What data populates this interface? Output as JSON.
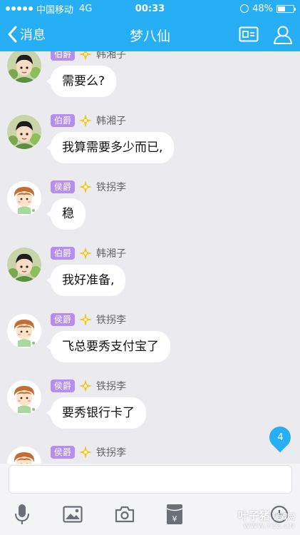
{
  "status_bar": {
    "carrier": "中国移动",
    "network": "4G",
    "time": "00:33",
    "battery": "48%",
    "battery_level": 0.48
  },
  "nav": {
    "back_label": "消息",
    "title": "梦八仙"
  },
  "messages": [
    {
      "rank": "伯爵",
      "sender": "韩湘子",
      "text": "需要么?"
    },
    {
      "rank": "伯爵",
      "sender": "韩湘子",
      "text": "我算需要多少而已,"
    },
    {
      "rank": "侯爵",
      "sender": "铁拐李",
      "text": "稳"
    },
    {
      "rank": "伯爵",
      "sender": "韩湘子",
      "text": "我好准备,"
    },
    {
      "rank": "侯爵",
      "sender": "铁拐李",
      "text": "飞总要秀支付宝了"
    },
    {
      "rank": "侯爵",
      "sender": "铁拐李",
      "text": "要秀银行卡了"
    },
    {
      "rank": "侯爵",
      "sender": "铁拐李",
      "text": ""
    }
  ],
  "unread_count": "4",
  "input": {
    "value": "",
    "placeholder": ""
  },
  "toolbar": [
    "microphone-icon",
    "image-icon",
    "camera-icon",
    "red-packet-icon",
    "more-icon"
  ],
  "watermark": {
    "main": "叶子猪",
    "sub": "游戏网",
    "url": "WWW.YZZ.CN"
  },
  "colors": {
    "accent": "#27aff5",
    "badge": "#b68ef0",
    "background": "#ebebef"
  }
}
